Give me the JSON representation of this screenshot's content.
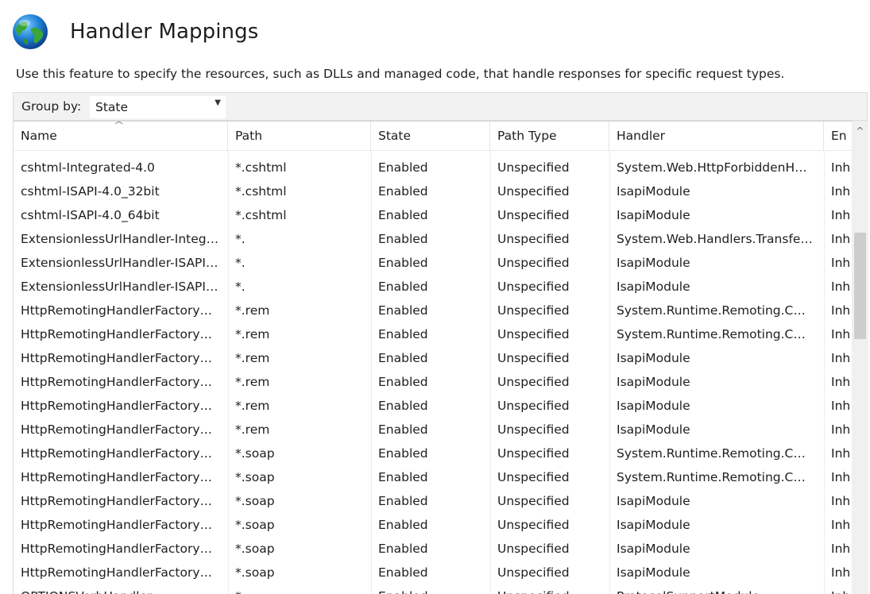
{
  "page": {
    "title": "Handler Mappings",
    "description": "Use this feature to specify the resources, such as DLLs and managed code, that handle responses for specific request types."
  },
  "group_by": {
    "label": "Group by:",
    "value": "State"
  },
  "columns": [
    "Name",
    "Path",
    "State",
    "Path Type",
    "Handler",
    "En"
  ],
  "rows": [
    [
      "cshtml-Integrated-4.0",
      "*.cshtml",
      "Enabled",
      "Unspecified",
      "System.Web.HttpForbiddenH…",
      "Inh"
    ],
    [
      "cshtml-ISAPI-4.0_32bit",
      "*.cshtml",
      "Enabled",
      "Unspecified",
      "IsapiModule",
      "Inh"
    ],
    [
      "cshtml-ISAPI-4.0_64bit",
      "*.cshtml",
      "Enabled",
      "Unspecified",
      "IsapiModule",
      "Inh"
    ],
    [
      "ExtensionlessUrlHandler-Integ…",
      "*.",
      "Enabled",
      "Unspecified",
      "System.Web.Handlers.Transfe…",
      "Inh"
    ],
    [
      "ExtensionlessUrlHandler-ISAPI…",
      "*.",
      "Enabled",
      "Unspecified",
      "IsapiModule",
      "Inh"
    ],
    [
      "ExtensionlessUrlHandler-ISAPI…",
      "*.",
      "Enabled",
      "Unspecified",
      "IsapiModule",
      "Inh"
    ],
    [
      "HttpRemotingHandlerFactory…",
      "*.rem",
      "Enabled",
      "Unspecified",
      "System.Runtime.Remoting.C…",
      "Inh"
    ],
    [
      "HttpRemotingHandlerFactory…",
      "*.rem",
      "Enabled",
      "Unspecified",
      "System.Runtime.Remoting.C…",
      "Inh"
    ],
    [
      "HttpRemotingHandlerFactory…",
      "*.rem",
      "Enabled",
      "Unspecified",
      "IsapiModule",
      "Inh"
    ],
    [
      "HttpRemotingHandlerFactory…",
      "*.rem",
      "Enabled",
      "Unspecified",
      "IsapiModule",
      "Inh"
    ],
    [
      "HttpRemotingHandlerFactory…",
      "*.rem",
      "Enabled",
      "Unspecified",
      "IsapiModule",
      "Inh"
    ],
    [
      "HttpRemotingHandlerFactory…",
      "*.rem",
      "Enabled",
      "Unspecified",
      "IsapiModule",
      "Inh"
    ],
    [
      "HttpRemotingHandlerFactory…",
      "*.soap",
      "Enabled",
      "Unspecified",
      "System.Runtime.Remoting.C…",
      "Inh"
    ],
    [
      "HttpRemotingHandlerFactory…",
      "*.soap",
      "Enabled",
      "Unspecified",
      "System.Runtime.Remoting.C…",
      "Inh"
    ],
    [
      "HttpRemotingHandlerFactory…",
      "*.soap",
      "Enabled",
      "Unspecified",
      "IsapiModule",
      "Inh"
    ],
    [
      "HttpRemotingHandlerFactory…",
      "*.soap",
      "Enabled",
      "Unspecified",
      "IsapiModule",
      "Inh"
    ],
    [
      "HttpRemotingHandlerFactory…",
      "*.soap",
      "Enabled",
      "Unspecified",
      "IsapiModule",
      "Inh"
    ],
    [
      "HttpRemotingHandlerFactory…",
      "*.soap",
      "Enabled",
      "Unspecified",
      "IsapiModule",
      "Inh"
    ],
    [
      "OPTIONSVerbHandler",
      "*",
      "Enabled",
      "Unspecified",
      "ProtocolSupportModule",
      "Inh"
    ]
  ],
  "icons": {
    "feature": "globe-icon",
    "dropdown": "chevron-down-icon",
    "sort": "sort-ascending-icon",
    "scroll_up": "scroll-up-arrow-icon"
  }
}
